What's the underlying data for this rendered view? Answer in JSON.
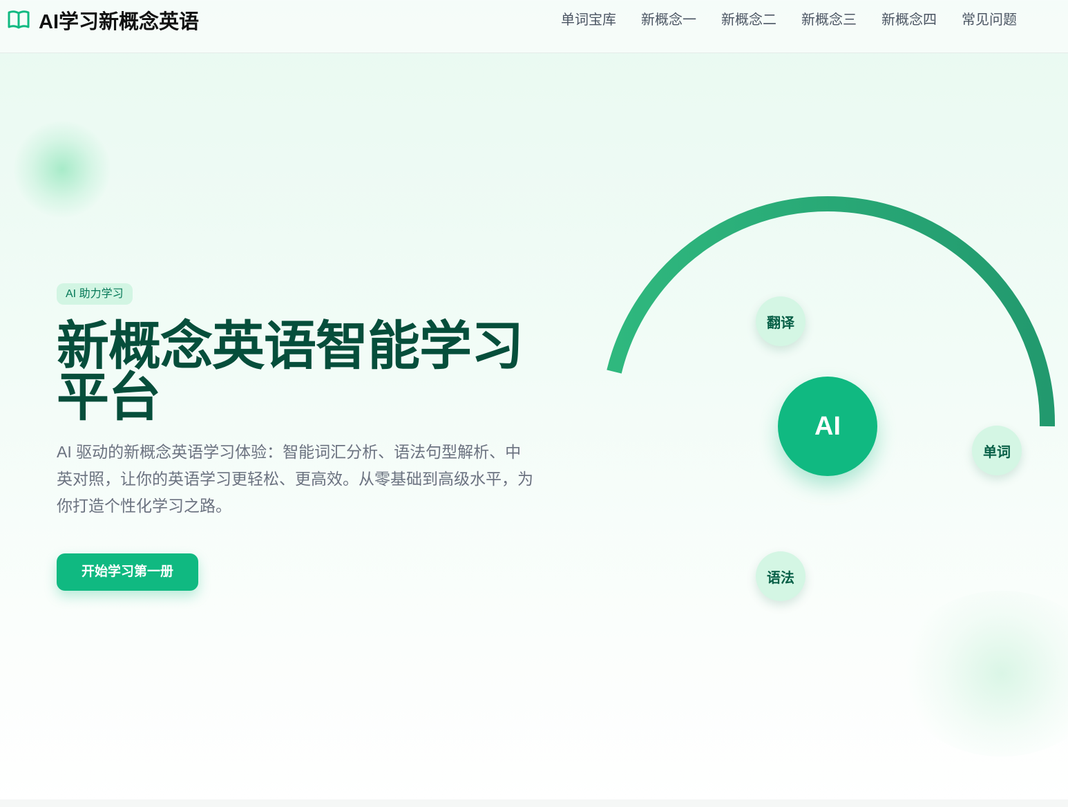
{
  "header": {
    "logo_text": "AI学习新概念英语",
    "logo_icon": "open-book-icon",
    "nav": [
      {
        "label": "单词宝库"
      },
      {
        "label": "新概念一"
      },
      {
        "label": "新概念二"
      },
      {
        "label": "新概念三"
      },
      {
        "label": "新概念四"
      },
      {
        "label": "常见问题"
      }
    ]
  },
  "hero": {
    "badge": "AI 助力学习",
    "title": "新概念英语智能学习平台",
    "description": "AI 驱动的新概念英语学习体验：智能词汇分析、语法句型解析、中英对照，让你的英语学习更轻松、更高效。从零基础到高级水平，为你打造个性化学习之路。",
    "cta": "开始学习第一册"
  },
  "illustration": {
    "center": "AI",
    "bubbles": {
      "translate": "翻译",
      "words": "单词",
      "grammar": "语法"
    }
  },
  "colors": {
    "accent": "#10b981",
    "title": "#064e3b",
    "badge_bg": "#d2f5e3",
    "bubble_bg": "#d4f6e4"
  }
}
